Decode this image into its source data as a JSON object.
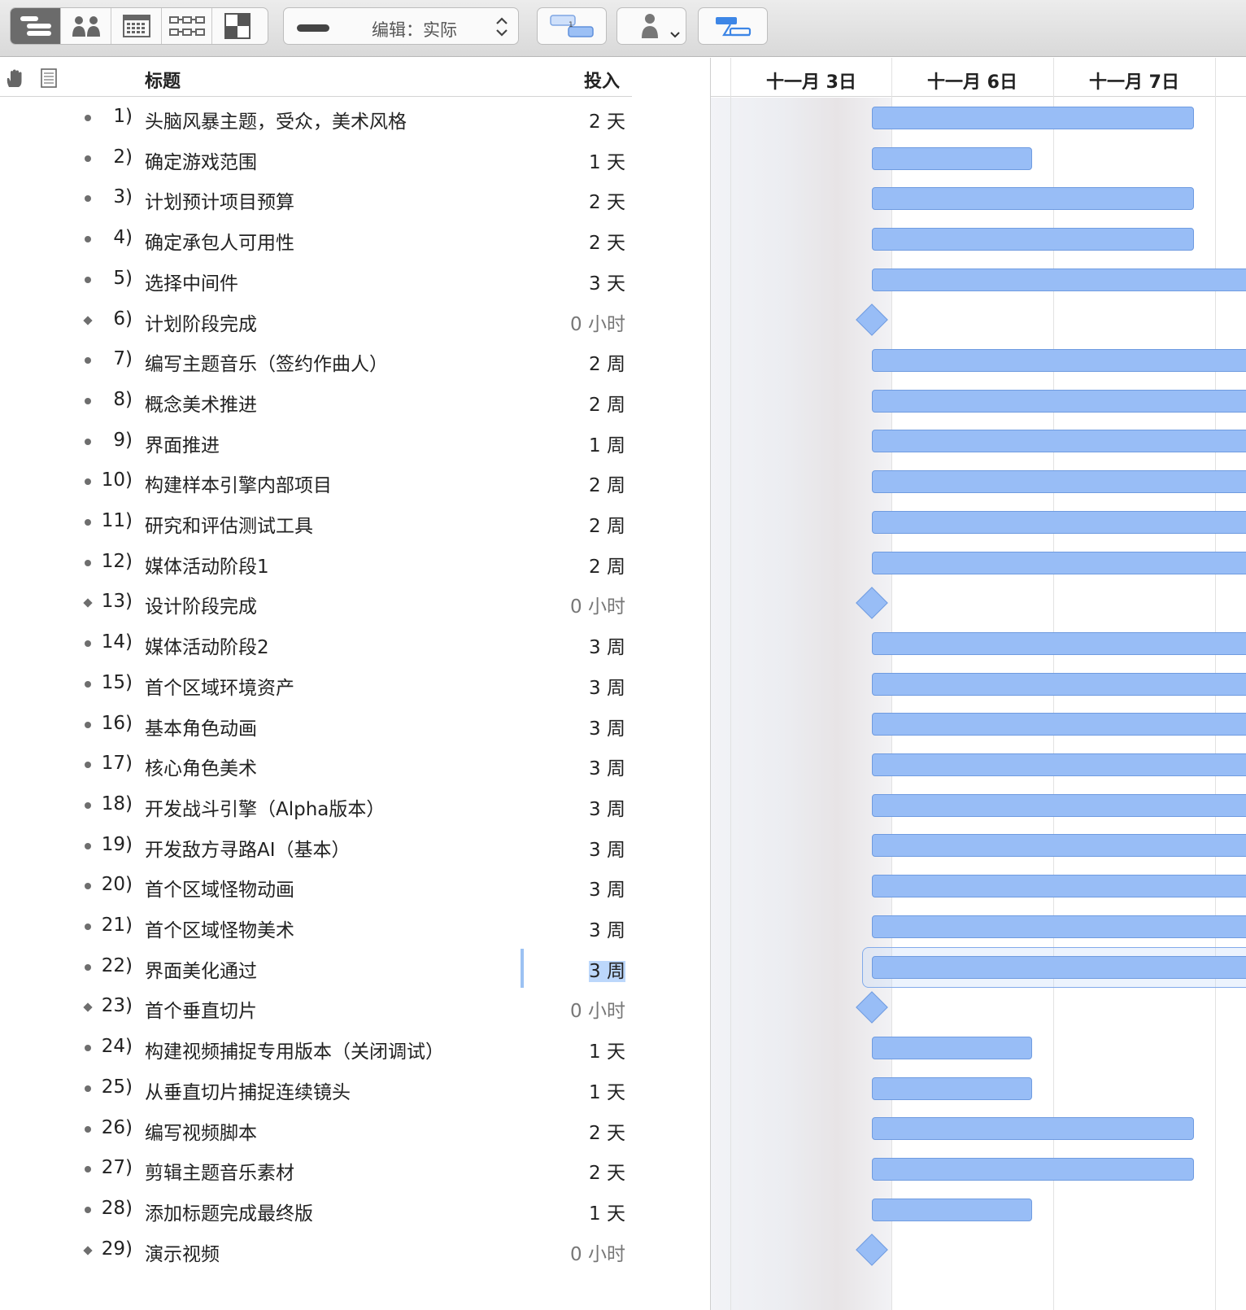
{
  "toolbar": {
    "edit_mode_label": "编辑：实际",
    "view_buttons": [
      "outline-view",
      "resource-view",
      "calendar-view",
      "network-view",
      "styles-view"
    ],
    "colors": {
      "toolbar_bg": "#dcdcdc",
      "active_segment": "#6b6b6b"
    }
  },
  "outline": {
    "columns": {
      "title": "标题",
      "effort": "投入"
    },
    "tasks": [
      {
        "num": "1)",
        "title": "头脑风暴主题，受众，美术风格",
        "effort": "2 天",
        "type": "task"
      },
      {
        "num": "2)",
        "title": "确定游戏范围",
        "effort": "1 天",
        "type": "task"
      },
      {
        "num": "3)",
        "title": "计划预计项目预算",
        "effort": "2 天",
        "type": "task"
      },
      {
        "num": "4)",
        "title": "确定承包人可用性",
        "effort": "2 天",
        "type": "task"
      },
      {
        "num": "5)",
        "title": "选择中间件",
        "effort": "3 天",
        "type": "task"
      },
      {
        "num": "6)",
        "title": "计划阶段完成",
        "effort": "0 小时",
        "type": "milestone"
      },
      {
        "num": "7)",
        "title": "编写主题音乐（签约作曲人）",
        "effort": "2 周",
        "type": "task"
      },
      {
        "num": "8)",
        "title": "概念美术推进",
        "effort": "2 周",
        "type": "task"
      },
      {
        "num": "9)",
        "title": "界面推进",
        "effort": "1 周",
        "type": "task"
      },
      {
        "num": "10)",
        "title": "构建样本引擎内部项目",
        "effort": "2 周",
        "type": "task"
      },
      {
        "num": "11)",
        "title": "研究和评估测试工具",
        "effort": "2 周",
        "type": "task"
      },
      {
        "num": "12)",
        "title": "媒体活动阶段1",
        "effort": "2 周",
        "type": "task"
      },
      {
        "num": "13)",
        "title": "设计阶段完成",
        "effort": "0 小时",
        "type": "milestone"
      },
      {
        "num": "14)",
        "title": "媒体活动阶段2",
        "effort": "3 周",
        "type": "task"
      },
      {
        "num": "15)",
        "title": "首个区域环境资产",
        "effort": "3 周",
        "type": "task"
      },
      {
        "num": "16)",
        "title": "基本角色动画",
        "effort": "3 周",
        "type": "task"
      },
      {
        "num": "17)",
        "title": "核心角色美术",
        "effort": "3 周",
        "type": "task"
      },
      {
        "num": "18)",
        "title": "开发战斗引擎（Alpha版本）",
        "effort": "3 周",
        "type": "task"
      },
      {
        "num": "19)",
        "title": "开发敌方寻路AI（基本）",
        "effort": "3 周",
        "type": "task"
      },
      {
        "num": "20)",
        "title": "首个区域怪物动画",
        "effort": "3 周",
        "type": "task"
      },
      {
        "num": "21)",
        "title": "首个区域怪物美术",
        "effort": "3 周",
        "type": "task"
      },
      {
        "num": "22)",
        "title": "界面美化通过",
        "effort": "3 周",
        "type": "task",
        "selected": true
      },
      {
        "num": "23)",
        "title": "首个垂直切片",
        "effort": "0 小时",
        "type": "milestone"
      },
      {
        "num": "24)",
        "title": "构建视频捕捉专用版本（关闭调试）",
        "effort": "1 天",
        "type": "task"
      },
      {
        "num": "25)",
        "title": "从垂直切片捕捉连续镜头",
        "effort": "1 天",
        "type": "task"
      },
      {
        "num": "26)",
        "title": "编写视频脚本",
        "effort": "2 天",
        "type": "task"
      },
      {
        "num": "27)",
        "title": "剪辑主题音乐素材",
        "effort": "2 天",
        "type": "task"
      },
      {
        "num": "28)",
        "title": "添加标题完成最终版",
        "effort": "1 天",
        "type": "task"
      },
      {
        "num": "29)",
        "title": "演示视频",
        "effort": "0 小时",
        "type": "milestone"
      }
    ]
  },
  "gantt": {
    "days": [
      "十一月 3日",
      "十一月 6日",
      "十一月 7日"
    ],
    "bar_color": "#98bdf6",
    "bar_days": [
      2,
      1,
      2,
      2,
      3,
      0,
      10,
      10,
      5,
      10,
      10,
      10,
      0,
      15,
      15,
      15,
      15,
      15,
      15,
      15,
      15,
      15,
      0,
      1,
      1,
      2,
      2,
      1,
      0
    ]
  }
}
